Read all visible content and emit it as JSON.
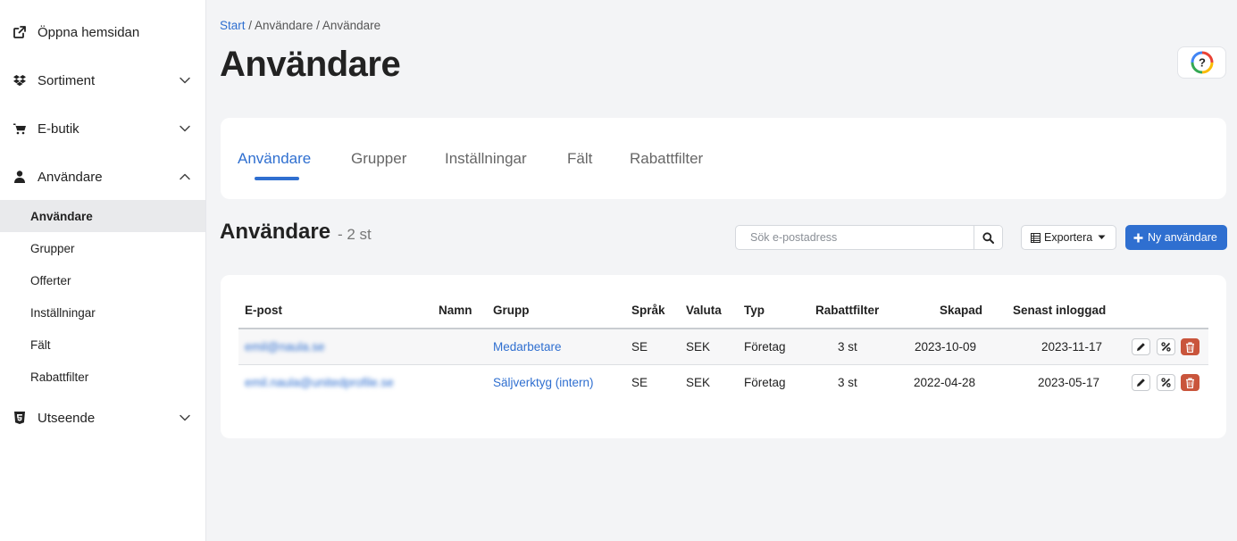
{
  "sidebar": {
    "items": [
      {
        "label": "Öppna hemsidan",
        "icon": "external-link-icon"
      },
      {
        "label": "Sortiment",
        "icon": "dropbox-icon"
      },
      {
        "label": "E-butik",
        "icon": "cart-icon"
      },
      {
        "label": "Användare",
        "icon": "user-icon"
      },
      {
        "label": "Utseende",
        "icon": "html5-icon"
      }
    ],
    "subitems": [
      "Användare",
      "Grupper",
      "Offerter",
      "Inställningar",
      "Fält",
      "Rabattfilter"
    ]
  },
  "breadcrumb": {
    "start": "Start",
    "rest": " / Användare / Användare"
  },
  "page_title": "Användare",
  "tabs": [
    "Användare",
    "Grupper",
    "Inställningar",
    "Fält",
    "Rabattfilter"
  ],
  "section": {
    "title": "Användare",
    "count": "- 2 st"
  },
  "search": {
    "placeholder": "Sök e-postadress"
  },
  "export_label": "Exportera",
  "new_user_label": "Ny användare",
  "table": {
    "headers": [
      "E-post",
      "Namn",
      "Grupp",
      "Språk",
      "Valuta",
      "Typ",
      "Rabattfilter",
      "Skapad",
      "Senast inloggad"
    ],
    "rows": [
      {
        "email": "emil@naula.se",
        "name": "",
        "group": "Medarbetare",
        "lang": "SE",
        "currency": "SEK",
        "type": "Företag",
        "filters": "3 st",
        "created": "2023-10-09",
        "last_login": "2023-11-17"
      },
      {
        "email": "emil.naula@unitedprofile.se",
        "name": "",
        "group": "Säljverktyg (intern)",
        "lang": "SE",
        "currency": "SEK",
        "type": "Företag",
        "filters": "3 st",
        "created": "2022-04-28",
        "last_login": "2023-05-17"
      }
    ]
  },
  "colors": {
    "accent": "#2f6fd0",
    "danger": "#c9553c",
    "background": "#f3f4f6"
  }
}
